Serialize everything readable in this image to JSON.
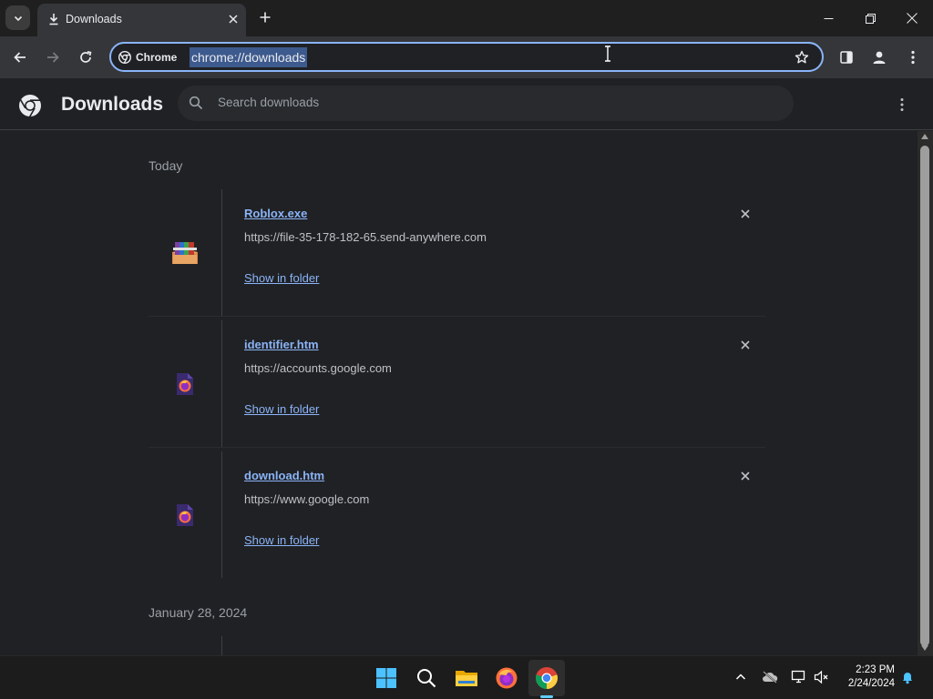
{
  "window": {
    "tab_title": "Downloads",
    "minimize_icon": "minimize-icon",
    "restore_icon": "restore-icon",
    "close_icon": "close-icon"
  },
  "toolbar": {
    "chip_label": "Chrome",
    "url": "chrome://downloads"
  },
  "page": {
    "title": "Downloads",
    "search_placeholder": "Search downloads"
  },
  "groups": [
    {
      "date": "Today",
      "items": [
        {
          "name": "Roblox.exe",
          "url": "https://file-35-178-182-65.send-anywhere.com",
          "action": "Show in folder",
          "icon": "winrar-archive-icon"
        },
        {
          "name": "identifier.htm",
          "url": "https://accounts.google.com",
          "action": "Show in folder",
          "icon": "firefox-html-file-icon"
        },
        {
          "name": "download.htm",
          "url": "https://www.google.com",
          "action": "Show in folder",
          "icon": "firefox-html-file-icon"
        }
      ]
    },
    {
      "date": "January 28, 2024",
      "items": []
    }
  ],
  "taskbar": {
    "apps": [
      "windows-start",
      "search",
      "file-explorer",
      "firefox",
      "chrome"
    ],
    "time": "2:23 PM",
    "date": "2/24/2024"
  },
  "colors": {
    "accent": "#8ab4f8",
    "background": "#202124",
    "toolbar": "#35363a"
  }
}
